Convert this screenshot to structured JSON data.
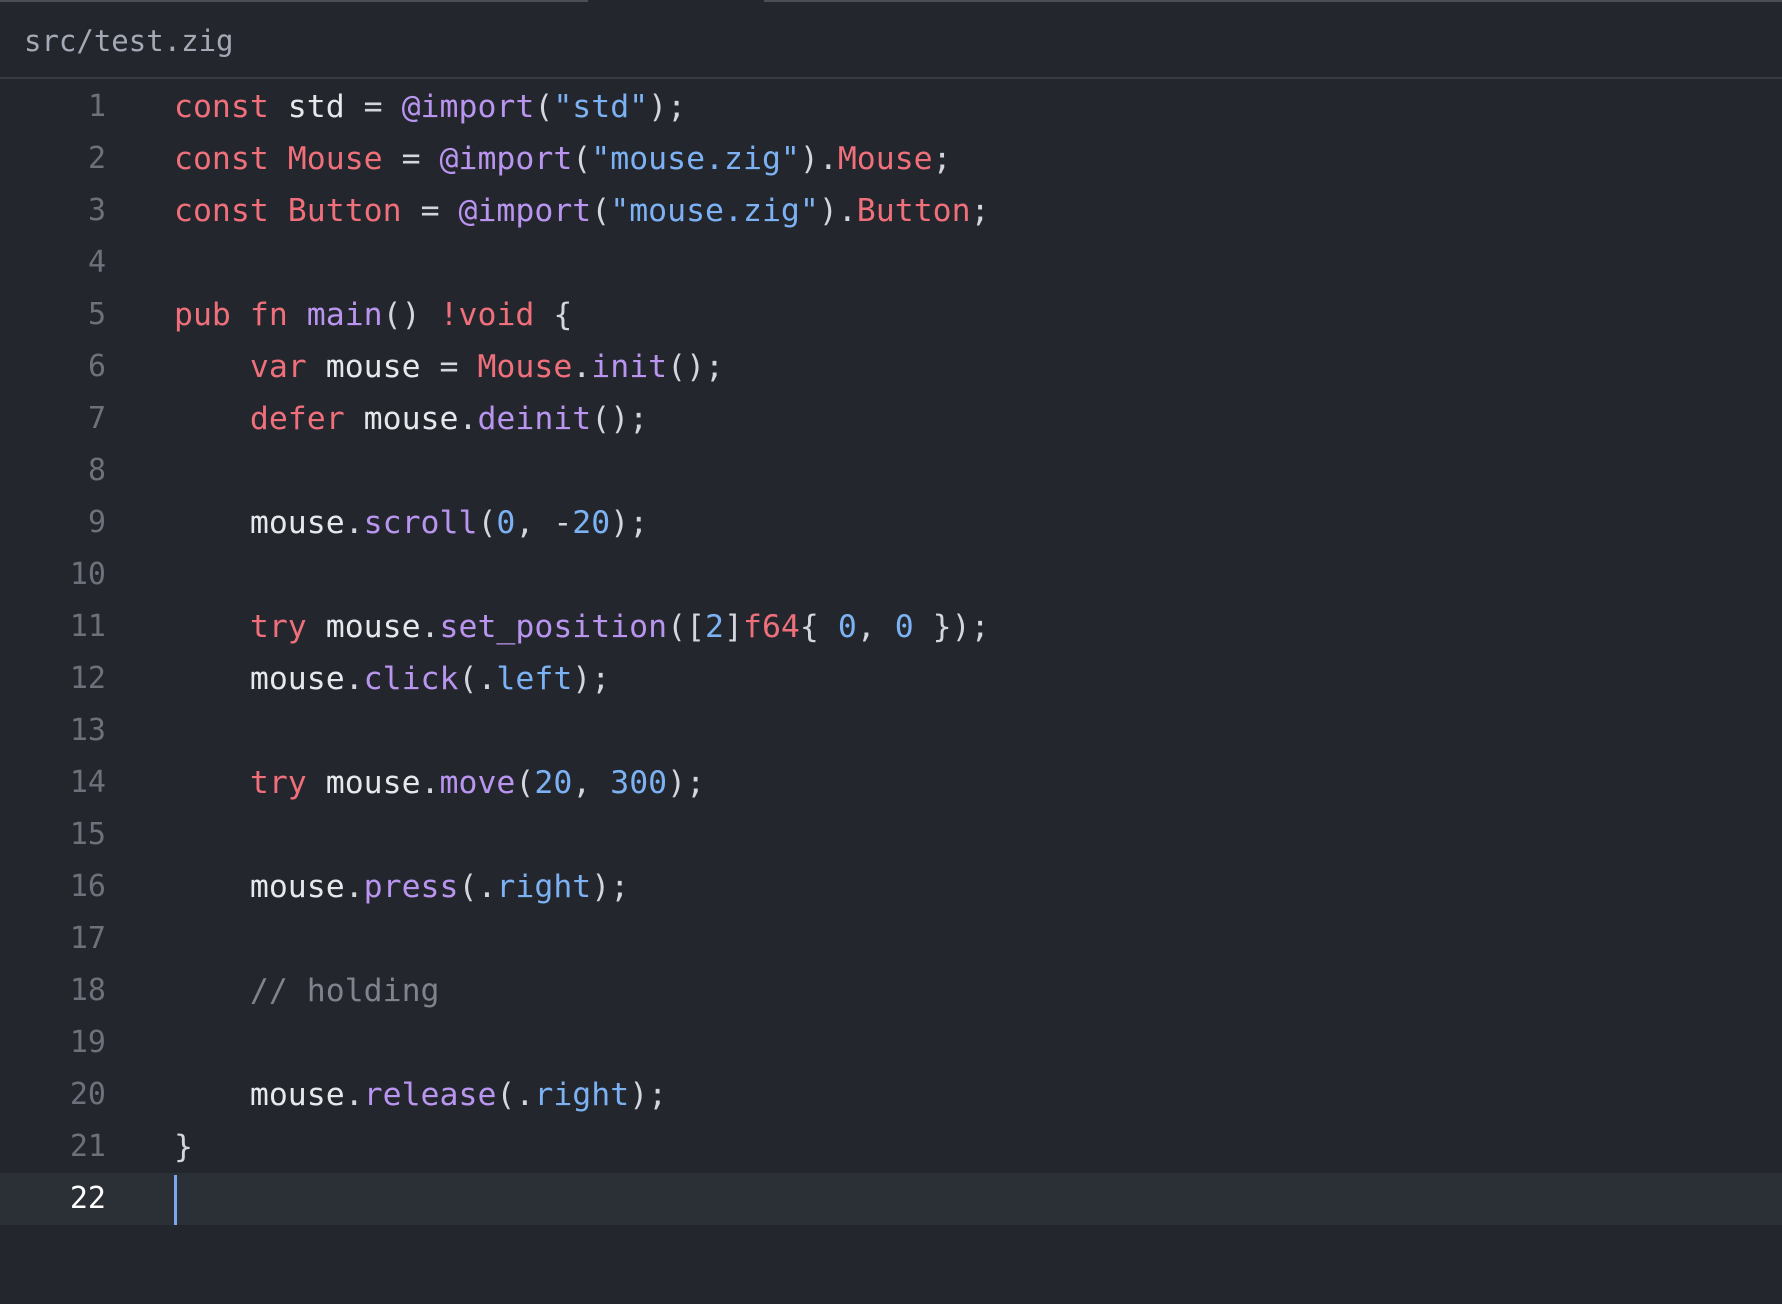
{
  "tab": {
    "title": "src/test.zig"
  },
  "editor": {
    "current_line": 22,
    "lines": [
      {
        "n": "1",
        "tokens": [
          [
            "kw",
            "const"
          ],
          [
            "id",
            " std "
          ],
          [
            "pun",
            "= "
          ],
          [
            "fn",
            "@import"
          ],
          [
            "pun",
            "("
          ],
          [
            "str",
            "\"std\""
          ],
          [
            "pun",
            ");"
          ]
        ]
      },
      {
        "n": "2",
        "tokens": [
          [
            "kw",
            "const"
          ],
          [
            "id",
            " "
          ],
          [
            "type",
            "Mouse"
          ],
          [
            "id",
            " "
          ],
          [
            "pun",
            "= "
          ],
          [
            "fn",
            "@import"
          ],
          [
            "pun",
            "("
          ],
          [
            "str",
            "\"mouse.zig\""
          ],
          [
            "pun",
            ")."
          ],
          [
            "type",
            "Mouse"
          ],
          [
            "pun",
            ";"
          ]
        ]
      },
      {
        "n": "3",
        "tokens": [
          [
            "kw",
            "const"
          ],
          [
            "id",
            " "
          ],
          [
            "type",
            "Button"
          ],
          [
            "id",
            " "
          ],
          [
            "pun",
            "= "
          ],
          [
            "fn",
            "@import"
          ],
          [
            "pun",
            "("
          ],
          [
            "str",
            "\"mouse.zig\""
          ],
          [
            "pun",
            ")."
          ],
          [
            "type",
            "Button"
          ],
          [
            "pun",
            ";"
          ]
        ]
      },
      {
        "n": "4",
        "tokens": []
      },
      {
        "n": "5",
        "tokens": [
          [
            "kw",
            "pub"
          ],
          [
            "id",
            " "
          ],
          [
            "kw",
            "fn"
          ],
          [
            "id",
            " "
          ],
          [
            "fn",
            "main"
          ],
          [
            "pun",
            "() "
          ],
          [
            "kw",
            "!void"
          ],
          [
            "pun",
            " {"
          ]
        ]
      },
      {
        "n": "6",
        "tokens": [
          [
            "id",
            "    "
          ],
          [
            "kw",
            "var"
          ],
          [
            "id",
            " mouse "
          ],
          [
            "pun",
            "= "
          ],
          [
            "type",
            "Mouse"
          ],
          [
            "pun",
            "."
          ],
          [
            "fn",
            "init"
          ],
          [
            "pun",
            "();"
          ]
        ]
      },
      {
        "n": "7",
        "tokens": [
          [
            "id",
            "    "
          ],
          [
            "kw",
            "defer"
          ],
          [
            "id",
            " mouse"
          ],
          [
            "pun",
            "."
          ],
          [
            "fn",
            "deinit"
          ],
          [
            "pun",
            "();"
          ]
        ]
      },
      {
        "n": "8",
        "tokens": []
      },
      {
        "n": "9",
        "tokens": [
          [
            "id",
            "    mouse"
          ],
          [
            "pun",
            "."
          ],
          [
            "fn",
            "scroll"
          ],
          [
            "pun",
            "("
          ],
          [
            "num",
            "0"
          ],
          [
            "pun",
            ", -"
          ],
          [
            "num",
            "20"
          ],
          [
            "pun",
            ");"
          ]
        ]
      },
      {
        "n": "10",
        "tokens": []
      },
      {
        "n": "11",
        "tokens": [
          [
            "id",
            "    "
          ],
          [
            "kw",
            "try"
          ],
          [
            "id",
            " mouse"
          ],
          [
            "pun",
            "."
          ],
          [
            "fn",
            "set_position"
          ],
          [
            "pun",
            "(["
          ],
          [
            "num",
            "2"
          ],
          [
            "pun",
            "]"
          ],
          [
            "type",
            "f64"
          ],
          [
            "pun",
            "{ "
          ],
          [
            "num",
            "0"
          ],
          [
            "pun",
            ", "
          ],
          [
            "num",
            "0"
          ],
          [
            "pun",
            " });"
          ]
        ]
      },
      {
        "n": "12",
        "tokens": [
          [
            "id",
            "    mouse"
          ],
          [
            "pun",
            "."
          ],
          [
            "fn",
            "click"
          ],
          [
            "pun",
            "(."
          ],
          [
            "enum",
            "left"
          ],
          [
            "pun",
            ");"
          ]
        ]
      },
      {
        "n": "13",
        "tokens": []
      },
      {
        "n": "14",
        "tokens": [
          [
            "id",
            "    "
          ],
          [
            "kw",
            "try"
          ],
          [
            "id",
            " mouse"
          ],
          [
            "pun",
            "."
          ],
          [
            "fn",
            "move"
          ],
          [
            "pun",
            "("
          ],
          [
            "num",
            "20"
          ],
          [
            "pun",
            ", "
          ],
          [
            "num",
            "300"
          ],
          [
            "pun",
            ");"
          ]
        ]
      },
      {
        "n": "15",
        "tokens": []
      },
      {
        "n": "16",
        "tokens": [
          [
            "id",
            "    mouse"
          ],
          [
            "pun",
            "."
          ],
          [
            "fn",
            "press"
          ],
          [
            "pun",
            "(."
          ],
          [
            "enum",
            "right"
          ],
          [
            "pun",
            ");"
          ]
        ]
      },
      {
        "n": "17",
        "tokens": []
      },
      {
        "n": "18",
        "tokens": [
          [
            "id",
            "    "
          ],
          [
            "com",
            "// holding"
          ]
        ]
      },
      {
        "n": "19",
        "tokens": []
      },
      {
        "n": "20",
        "tokens": [
          [
            "id",
            "    mouse"
          ],
          [
            "pun",
            "."
          ],
          [
            "fn",
            "release"
          ],
          [
            "pun",
            "(."
          ],
          [
            "enum",
            "right"
          ],
          [
            "pun",
            ");"
          ]
        ]
      },
      {
        "n": "21",
        "tokens": [
          [
            "pun",
            "}"
          ]
        ]
      },
      {
        "n": "22",
        "tokens": []
      }
    ]
  },
  "colors": {
    "background": "#23262c",
    "current_line": "#2b2f36",
    "keyword": "#ef6f7b",
    "function": "#b995f0",
    "string": "#7cb2f4",
    "comment": "#7e838d",
    "caret": "#7aa7ef"
  }
}
